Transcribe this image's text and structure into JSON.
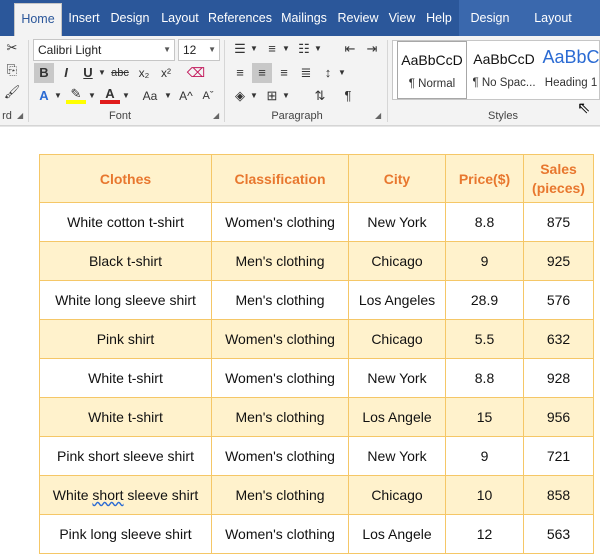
{
  "tabs": [
    {
      "label": "Home",
      "active": true
    },
    {
      "label": "Insert"
    },
    {
      "label": "Design"
    },
    {
      "label": "Layout"
    },
    {
      "label": "References"
    },
    {
      "label": "Mailings"
    },
    {
      "label": "Review"
    },
    {
      "label": "View"
    },
    {
      "label": "Help"
    }
  ],
  "context_tabs": [
    "Design",
    "Layout"
  ],
  "ribbon": {
    "clipboard_label_partial": "rd",
    "font": {
      "group_label": "Font",
      "font_name": "Calibri Light",
      "font_size": "12"
    },
    "paragraph": {
      "group_label": "Paragraph"
    },
    "styles": {
      "group_label": "Styles",
      "items": [
        {
          "sample": "AaBbCcD",
          "name": "¶ Normal"
        },
        {
          "sample": "AaBbCcD",
          "name": "¶ No Spac..."
        },
        {
          "sample": "AaBbC",
          "name": "Heading 1"
        }
      ]
    }
  },
  "table": {
    "headers": [
      "Clothes",
      "Classification",
      "City",
      "Price($)",
      "Sales\n(pieces)"
    ],
    "rows": [
      [
        "White cotton t-shirt",
        "Women's clothing",
        "New York",
        "8.8",
        "875"
      ],
      [
        "Black t-shirt",
        "Men's clothing",
        "Chicago",
        "9",
        "925"
      ],
      [
        "White long sleeve shirt",
        "Men's clothing",
        "Los Angeles",
        "28.9",
        "576"
      ],
      [
        "Pink shirt",
        "Women's clothing",
        "Chicago",
        "5.5",
        "632"
      ],
      [
        "White t-shirt",
        "Women's clothing",
        "New York",
        "8.8",
        "928"
      ],
      [
        "White t-shirt",
        "Men's clothing",
        "Los Angele",
        "15",
        "956"
      ],
      [
        "Pink short sleeve shirt",
        "Women's clothing",
        "New York",
        "9",
        "721"
      ],
      [
        "White short sleeve shirt",
        "Men's clothing",
        "Chicago",
        "10",
        "858"
      ],
      [
        "Pink long sleeve shirt",
        "Women's clothing",
        "Los Angele",
        "12",
        "563"
      ]
    ]
  },
  "colors": {
    "ribbon_blue": "#2b579a",
    "header_text": "#e8772e",
    "band_fill": "#fff2cc",
    "border": "#f5c767"
  }
}
